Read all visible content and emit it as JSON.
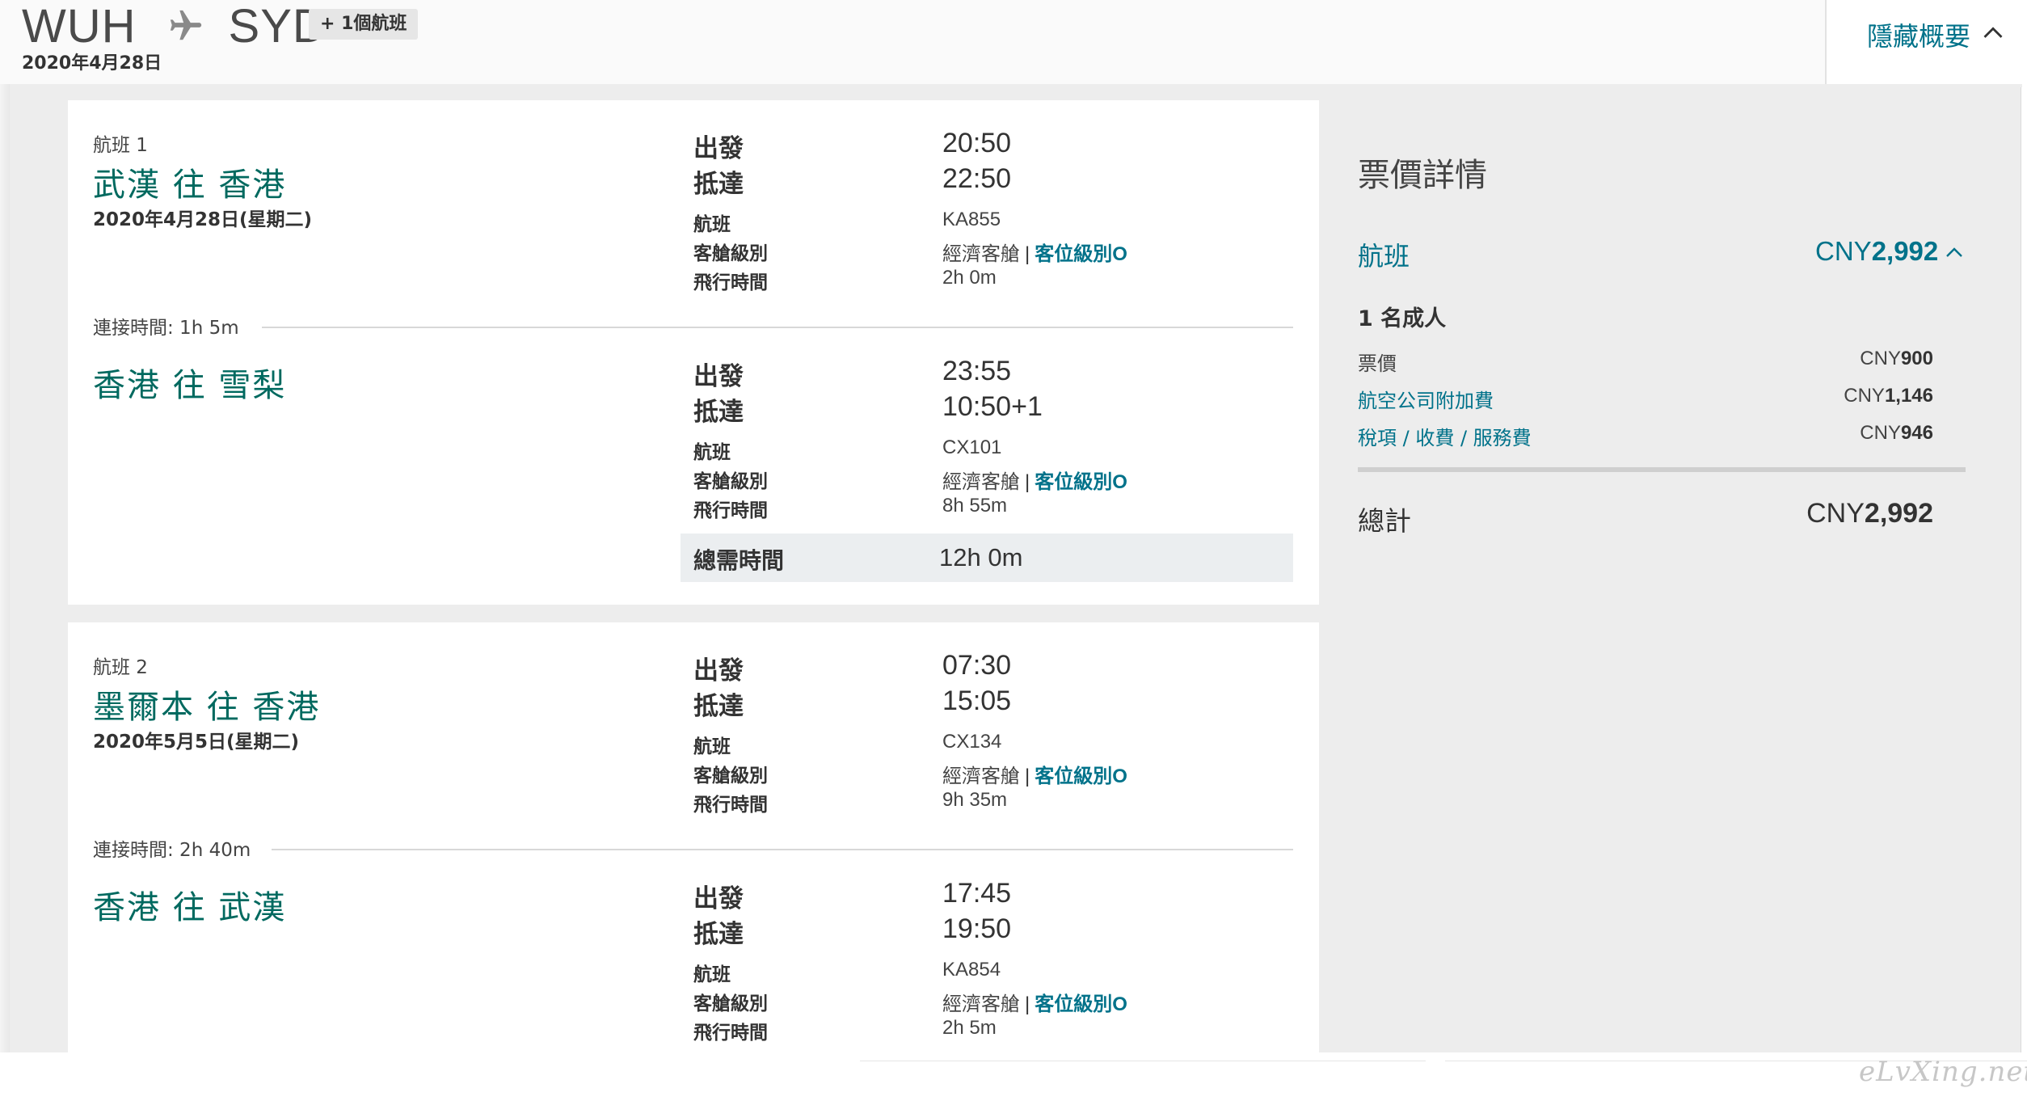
{
  "header": {
    "origin": "WUH",
    "destination": "SYD",
    "extra_flights_badge": "+ 1個航班",
    "date": "2020年4月28日",
    "toggle_label": "隱藏概要"
  },
  "journeys": [
    {
      "flight_no": "航班 1",
      "date": "2020年4月28日(星期二)",
      "segments": [
        {
          "title": "武漢 往 香港",
          "depart_label": "出發",
          "depart_time": "20:50",
          "arrive_label": "抵達",
          "arrive_time": "22:50",
          "flight_label": "航班",
          "flight": "KA855",
          "cabin_label": "客艙級別",
          "cabin": "經濟客艙",
          "separator": "|",
          "class_link": "客位級別O",
          "duration_label": "飛行時間",
          "duration": "2h 0m"
        },
        {
          "title": "香港 往 雪梨",
          "depart_label": "出發",
          "depart_time": "23:55",
          "arrive_label": "抵達",
          "arrive_time": "10:50+1",
          "flight_label": "航班",
          "flight": "CX101",
          "cabin_label": "客艙級別",
          "cabin": "經濟客艙",
          "separator": "|",
          "class_link": "客位級別O",
          "duration_label": "飛行時間",
          "duration": "8h 55m"
        }
      ],
      "connection": "連接時間:  1h 5m",
      "total_label": "總需時間",
      "total": "12h 0m"
    },
    {
      "flight_no": "航班 2",
      "date": "2020年5月5日(星期二)",
      "segments": [
        {
          "title": "墨爾本 往 香港",
          "depart_label": "出發",
          "depart_time": "07:30",
          "arrive_label": "抵達",
          "arrive_time": "15:05",
          "flight_label": "航班",
          "flight": "CX134",
          "cabin_label": "客艙級別",
          "cabin": "經濟客艙",
          "separator": "|",
          "class_link": "客位級別O",
          "duration_label": "飛行時間",
          "duration": "9h 35m"
        },
        {
          "title": "香港 往 武漢",
          "depart_label": "出發",
          "depart_time": "17:45",
          "arrive_label": "抵達",
          "arrive_time": "19:50",
          "flight_label": "航班",
          "flight": "KA854",
          "cabin_label": "客艙級別",
          "cabin": "經濟客艙",
          "separator": "|",
          "class_link": "客位級別O",
          "duration_label": "飛行時間",
          "duration": "2h 5m"
        }
      ],
      "connection": "連接時間:  2h 40m"
    }
  ],
  "fare": {
    "title": "票價詳情",
    "flight_label": "航班",
    "flight_currency": "CNY",
    "flight_amount": "2,992",
    "passengers": "1 名成人",
    "rows": [
      {
        "label": "票價",
        "currency": "CNY",
        "amount": "900"
      },
      {
        "label": "航空公司附加費",
        "currency": "CNY",
        "amount": "1,146"
      },
      {
        "label": "稅項 / 收費 / 服務費",
        "currency": "CNY",
        "amount": "946"
      }
    ],
    "total_label": "總計",
    "total_currency": "CNY",
    "total_amount": "2,992"
  },
  "watermark": "eLvXing.net",
  "colors": {
    "accent_teal": "#00728a",
    "city_green": "#00695f",
    "panel_gray": "#ededed"
  }
}
